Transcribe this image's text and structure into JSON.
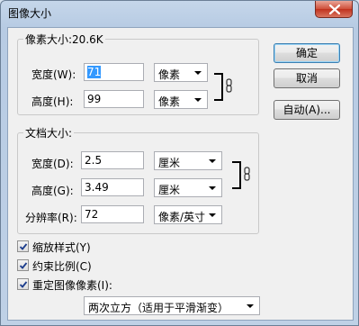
{
  "window": {
    "title": "图像大小"
  },
  "pixel_dimensions": {
    "legend": "像素大小:20.6K",
    "width": {
      "label": "宽度(W):",
      "value": "71",
      "unit": "像素"
    },
    "height": {
      "label": "高度(H):",
      "value": "99",
      "unit": "像素"
    }
  },
  "document_size": {
    "legend": "文档大小:",
    "width": {
      "label": "宽度(D):",
      "value": "2.5",
      "unit": "厘米"
    },
    "height": {
      "label": "高度(G):",
      "value": "3.49",
      "unit": "厘米"
    },
    "resolution": {
      "label": "分辨率(R):",
      "value": "72",
      "unit": "像素/英寸"
    }
  },
  "buttons": {
    "ok": "确定",
    "cancel": "取消",
    "auto": "自动(A)..."
  },
  "options": {
    "scale_styles": {
      "label": "缩放样式(Y)",
      "checked": true
    },
    "constrain_proportions": {
      "label": "约束比例(C)",
      "checked": true
    },
    "resample_image": {
      "label": "重定图像像素(I):",
      "checked": true
    }
  },
  "resample_method": {
    "selected": "两次立方（适用于平滑渐变）"
  },
  "colors": {
    "selection": "#3399ff",
    "close_button": "#c7432e",
    "default_button_border": "#3c7fb1"
  }
}
